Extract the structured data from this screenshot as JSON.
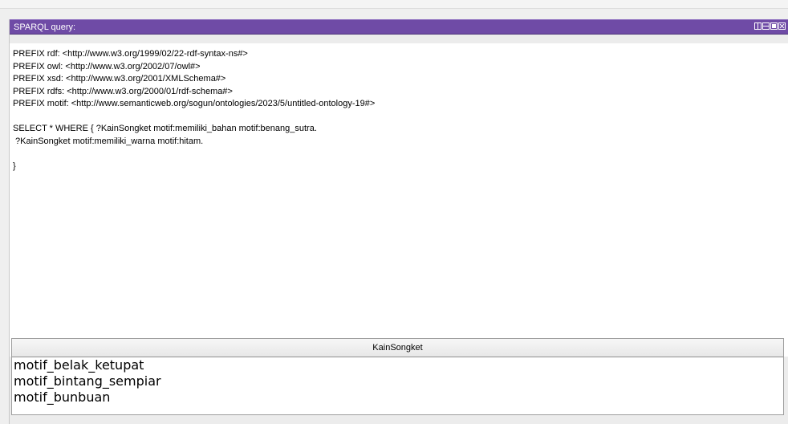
{
  "panel": {
    "title": "SPARQL query:"
  },
  "query_lines": [
    "PREFIX rdf: <http://www.w3.org/1999/02/22-rdf-syntax-ns#>",
    "PREFIX owl: <http://www.w3.org/2002/07/owl#>",
    "PREFIX xsd: <http://www.w3.org/2001/XMLSchema#>",
    "PREFIX rdfs: <http://www.w3.org/2000/01/rdf-schema#>",
    "PREFIX motif: <http://www.semanticweb.org/sogun/ontologies/2023/5/untitled-ontology-19#>",
    "",
    "SELECT * WHERE { ?KainSongket motif:memiliki_bahan motif:benang_sutra.",
    " ?KainSongket motif:memiliki_warna motif:hitam.",
    "",
    "}"
  ],
  "results": {
    "column_header": "KainSongket",
    "rows": [
      "motif_belak_ketupat",
      "motif_bintang_sempiar",
      "motif_bunbuan"
    ]
  },
  "colors": {
    "title_bar": "#6f4ba6",
    "title_text": "#ffffff",
    "editor_bg": "#ffffff"
  },
  "icons": [
    "split-view-icon",
    "horizontal-split-icon",
    "maximize-icon",
    "close-icon"
  ]
}
